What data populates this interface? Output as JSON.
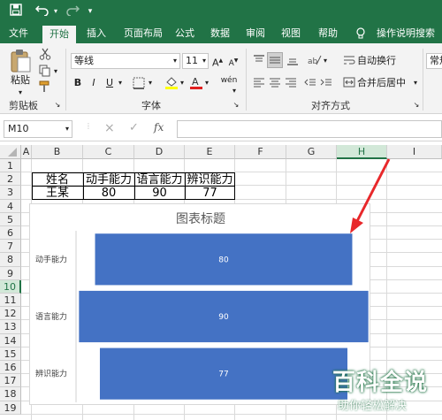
{
  "quick_access": {
    "save_icon": "save-icon",
    "undo_icon": "undo-icon",
    "redo_icon": "redo-icon",
    "customize_icon": "chevron-down-icon"
  },
  "tabs": [
    {
      "label": "文件"
    },
    {
      "label": "开始"
    },
    {
      "label": "插入"
    },
    {
      "label": "页面布局"
    },
    {
      "label": "公式"
    },
    {
      "label": "数据"
    },
    {
      "label": "审阅"
    },
    {
      "label": "视图"
    },
    {
      "label": "帮助"
    },
    {
      "label": "操作说明搜索"
    }
  ],
  "ribbon": {
    "clipboard": {
      "paste_label": "粘贴",
      "group_label": "剪贴板"
    },
    "font": {
      "name": "等线",
      "size": "11",
      "bold": "B",
      "italic": "I",
      "underline": "U",
      "group_label": "字体",
      "phonetic": "wén"
    },
    "alignment": {
      "wrap_text": "自动换行",
      "merge_center": "合并后居中",
      "group_label": "对齐方式"
    },
    "number": {
      "format": "常规"
    }
  },
  "formula_bar": {
    "name_box": "M10",
    "cancel": "×",
    "enter": "✓",
    "fx": "fx",
    "formula": ""
  },
  "columns": [
    "A",
    "B",
    "C",
    "D",
    "E",
    "F",
    "G",
    "H",
    "I"
  ],
  "rows": [
    "1",
    "2",
    "3",
    "4",
    "5",
    "6",
    "7",
    "8",
    "9",
    "10",
    "11",
    "12",
    "13",
    "14",
    "15",
    "16",
    "17",
    "18",
    "19"
  ],
  "table": {
    "headers": [
      "姓名",
      "动手能力",
      "语言能力",
      "辨识能力"
    ],
    "row": [
      "王某",
      "80",
      "90",
      "77"
    ]
  },
  "chart_data": {
    "type": "bar",
    "orientation": "horizontal",
    "title": "图表标题",
    "categories": [
      "动手能力",
      "语言能力",
      "辨识能力"
    ],
    "values": [
      80,
      90,
      77
    ],
    "color": "#4472c4",
    "data_labels": true
  },
  "watermark": {
    "title": "百科全说",
    "subtitle": "助你轻松解决"
  },
  "colors": {
    "excel_green": "#217346",
    "bar_blue": "#4472c4",
    "arrow_red": "#e8282b"
  }
}
